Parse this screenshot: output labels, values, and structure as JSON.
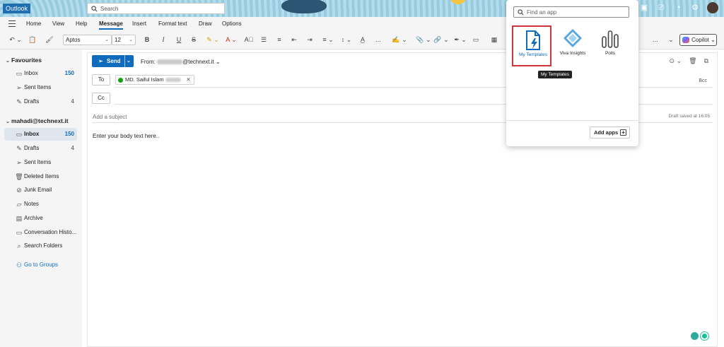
{
  "app": {
    "brand": "Outlook"
  },
  "search": {
    "placeholder": "Search"
  },
  "menu": {
    "tabs": [
      "Home",
      "View",
      "Help",
      "Message",
      "Insert",
      "Format text",
      "Draw",
      "Options"
    ],
    "active_index": 3
  },
  "ribbon": {
    "font_name": "Aptos",
    "font_size": "12",
    "more": "...",
    "copilot_label": "Copilot"
  },
  "sidebar": {
    "favourites_header": "Favourites",
    "favourites": [
      {
        "icon": "inbox-icon",
        "label": "Inbox",
        "count": "150",
        "bold": true
      },
      {
        "icon": "send-icon",
        "label": "Sent Items",
        "count": ""
      },
      {
        "icon": "pencil-icon",
        "label": "Drafts",
        "count": "4"
      }
    ],
    "account_header": "mahadi@technext.it",
    "folders": [
      {
        "icon": "inbox-icon",
        "label": "Inbox",
        "count": "150",
        "bold": true,
        "selected": true
      },
      {
        "icon": "pencil-icon",
        "label": "Drafts",
        "count": "4"
      },
      {
        "icon": "send-icon",
        "label": "Sent Items",
        "count": ""
      },
      {
        "icon": "trash-icon",
        "label": "Deleted Items",
        "count": ""
      },
      {
        "icon": "junk-icon",
        "label": "Junk Email",
        "count": ""
      },
      {
        "icon": "note-icon",
        "label": "Notes",
        "count": ""
      },
      {
        "icon": "archive-icon",
        "label": "Archive",
        "count": ""
      },
      {
        "icon": "folder-icon",
        "label": "Conversation Histo...",
        "count": ""
      },
      {
        "icon": "search-folder-icon",
        "label": "Search Folders",
        "count": ""
      }
    ],
    "groups_link": "Go to Groups"
  },
  "compose": {
    "send_label": "Send",
    "from_label": "From:",
    "from_domain": "@technext.it",
    "to_label": "To",
    "cc_label": "Cc",
    "bcc_label": "Bcc",
    "recipient_name": "MD. Saiful Islam",
    "subject_placeholder": "Add a subject",
    "draft_status": "Draft saved at 16:05",
    "body_text": "Enter your body text here.."
  },
  "apps_panel": {
    "search_placeholder": "Find an app",
    "apps": [
      {
        "label": "My Templates",
        "icon": "templates-icon"
      },
      {
        "label": "Viva Insights",
        "icon": "viva-insights-icon"
      },
      {
        "label": "Polls",
        "icon": "polls-icon"
      }
    ],
    "tooltip": "My Templates",
    "add_apps_label": "Add apps"
  },
  "colors": {
    "accent": "#0f6cbd",
    "highlight": "#d13438"
  }
}
